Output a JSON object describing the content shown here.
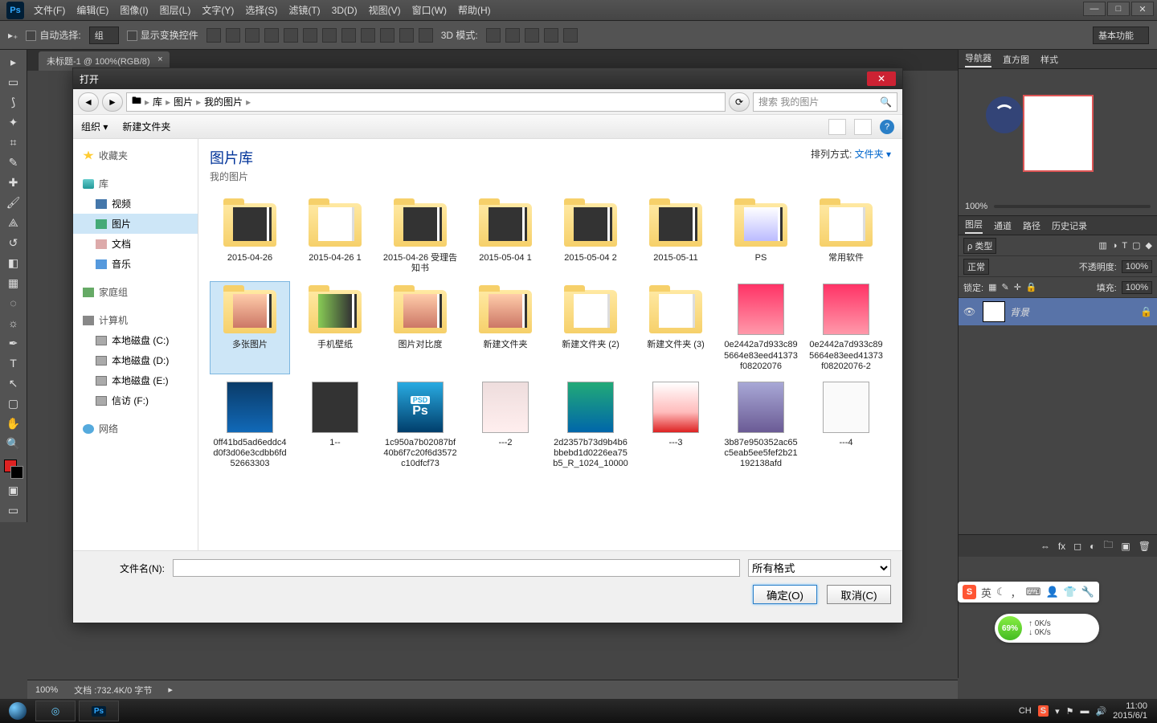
{
  "app": {
    "logo": "Ps"
  },
  "menu": [
    "文件(F)",
    "编辑(E)",
    "图像(I)",
    "图层(L)",
    "文字(Y)",
    "选择(S)",
    "滤镜(T)",
    "3D(D)",
    "视图(V)",
    "窗口(W)",
    "帮助(H)"
  ],
  "optbar": {
    "auto_select": "自动选择:",
    "auto_select_value": "组",
    "show_transform": "显示变换控件",
    "mode3d": "3D 模式:",
    "workspace": "基本功能"
  },
  "doc_tab": "未标题-1 @ 100%(RGB/8)",
  "right": {
    "nav_tabs": [
      "导航器",
      "直方图",
      "样式"
    ],
    "zoom": "100%",
    "layer_tabs": [
      "图层",
      "通道",
      "路径",
      "历史记录"
    ],
    "kind": "ρ 类型",
    "blend": "正常",
    "opacity_label": "不透明度:",
    "opacity_val": "100%",
    "lock_label": "锁定:",
    "fill_label": "填充:",
    "fill_val": "100%",
    "layer_name": "背景"
  },
  "status": {
    "zoom": "100%",
    "doc": "文档 :732.4K/0 字节"
  },
  "dialog": {
    "title": "打开",
    "crumb": [
      "库",
      "图片",
      "我的图片"
    ],
    "crumb_prefix_icon": "▸",
    "search_placeholder": "搜索 我的图片",
    "organize": "组织 ▾",
    "newfolder": "新建文件夹",
    "lib_title": "图片库",
    "lib_sub": "我的图片",
    "sort_label": "排列方式:",
    "sort_value": "文件夹 ▾",
    "sidebar": {
      "fav": "收藏夹",
      "lib": "库",
      "lib_items": [
        "视频",
        "图片",
        "文档",
        "音乐"
      ],
      "homegroup": "家庭组",
      "computer": "计算机",
      "drives": [
        "本地磁盘 (C:)",
        "本地磁盘 (D:)",
        "本地磁盘 (E:)",
        "信访 (F:)"
      ],
      "network": "网络"
    },
    "items_row1": [
      {
        "name": "2015-04-26",
        "t": "folder-dark"
      },
      {
        "name": "2015-04-26 1",
        "t": "folder-white"
      },
      {
        "name": "2015-04-26 受理告知书",
        "t": "folder-dark"
      },
      {
        "name": "2015-05-04 1",
        "t": "folder-dark"
      },
      {
        "name": "2015-05-04 2",
        "t": "folder-dark"
      },
      {
        "name": "2015-05-11",
        "t": "folder-dark"
      },
      {
        "name": "PS",
        "t": "folder-wp"
      },
      {
        "name": "常用软件",
        "t": "folder-white"
      }
    ],
    "items_row2": [
      {
        "name": "多张图片",
        "t": "folder-photo",
        "sel": true
      },
      {
        "name": "手机壁纸",
        "t": "folder-mix"
      },
      {
        "name": "图片对比度",
        "t": "folder-photo"
      },
      {
        "name": "新建文件夹",
        "t": "folder-photo"
      },
      {
        "name": "新建文件夹 (2)",
        "t": "folder-white"
      },
      {
        "name": "新建文件夹 (3)",
        "t": "folder-white"
      },
      {
        "name": "0e2442a7d933c895664e83eed41373f08202076",
        "t": "img-pink"
      },
      {
        "name": "0e2442a7d933c895664e83eed41373f08202076-2",
        "t": "img-pink"
      }
    ],
    "items_row3": [
      {
        "name": "0ff41bd5ad6eddc4d0f3d06e3cdbb6fd52663303",
        "t": "img-blue"
      },
      {
        "name": "1--",
        "t": "img-shot"
      },
      {
        "name": "1c950a7b02087bf40b6f7c20f6d3572c10dfcf73",
        "t": "img-psd"
      },
      {
        "name": "---2",
        "t": "img-people"
      },
      {
        "name": "2d2357b73d9b4b6bbebd1d0226ea75b5_R_1024_10000",
        "t": "img-sea"
      },
      {
        "name": "---3",
        "t": "img-red"
      },
      {
        "name": "3b87e950352ac65c5eab5ee5fef2b21192138afd",
        "t": "img-purple"
      },
      {
        "name": "---4",
        "t": "img-white"
      }
    ],
    "filename_label": "文件名(N):",
    "filetype": "所有格式",
    "ok": "确定(O)",
    "cancel": "取消(C)"
  },
  "ime": {
    "s": "S",
    "lang": "英"
  },
  "netw": {
    "pct": "69%",
    "up": "0K/s",
    "dn": "0K/s"
  },
  "tray": {
    "ch": "CH",
    "time": "11:00",
    "date": "2015/6/1"
  }
}
